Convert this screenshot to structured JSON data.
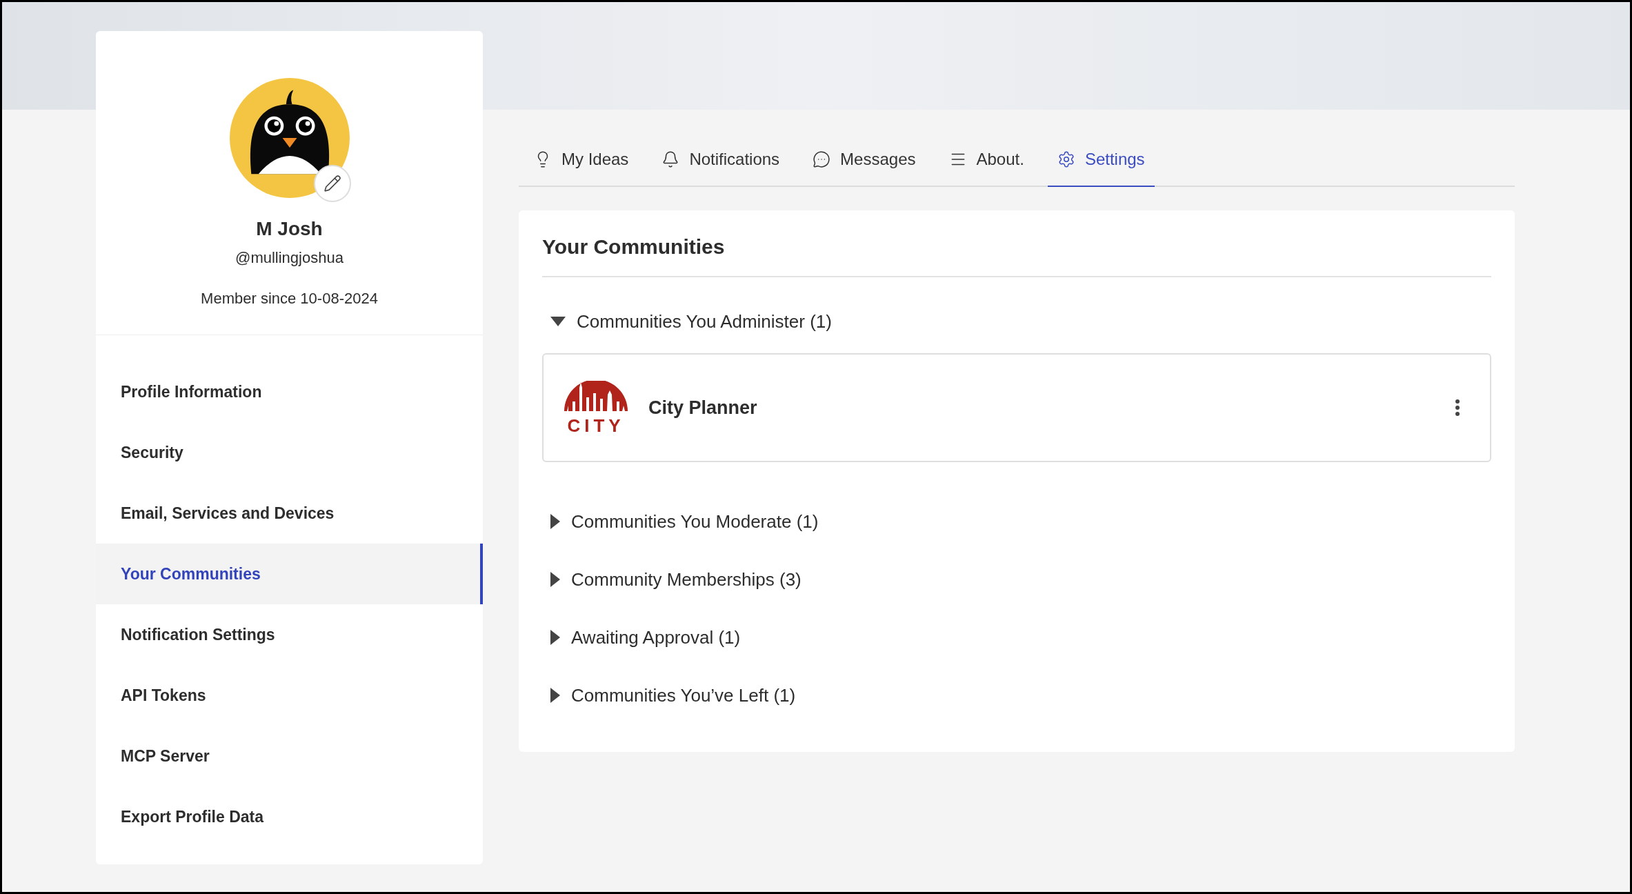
{
  "profile": {
    "name": "M Josh",
    "handle": "@mullingjoshua",
    "member_since": "Member since 10-08-2024"
  },
  "menu": [
    {
      "label": "Profile Information",
      "selected": false
    },
    {
      "label": "Security",
      "selected": false
    },
    {
      "label": "Email, Services and Devices",
      "selected": false
    },
    {
      "label": "Your Communities",
      "selected": true
    },
    {
      "label": "Notification Settings",
      "selected": false
    },
    {
      "label": "API Tokens",
      "selected": false
    },
    {
      "label": "MCP Server",
      "selected": false
    },
    {
      "label": "Export Profile Data",
      "selected": false
    }
  ],
  "tabs": [
    {
      "label": "My Ideas",
      "selected": false
    },
    {
      "label": "Notifications",
      "selected": false
    },
    {
      "label": "Messages",
      "selected": false
    },
    {
      "label": "About.",
      "selected": false
    },
    {
      "label": "Settings",
      "selected": true
    }
  ],
  "panel": {
    "title": "Your Communities",
    "sections": [
      {
        "label": "Communities You Administer (1)",
        "expanded": true,
        "communities": [
          {
            "name": "City Planner",
            "logo_text": "CITY"
          }
        ]
      },
      {
        "label": "Communities You Moderate (1)",
        "expanded": false
      },
      {
        "label": "Community Memberships (3)",
        "expanded": false
      },
      {
        "label": "Awaiting Approval (1)",
        "expanded": false
      },
      {
        "label": "Communities You’ve Left (1)",
        "expanded": false
      }
    ]
  }
}
